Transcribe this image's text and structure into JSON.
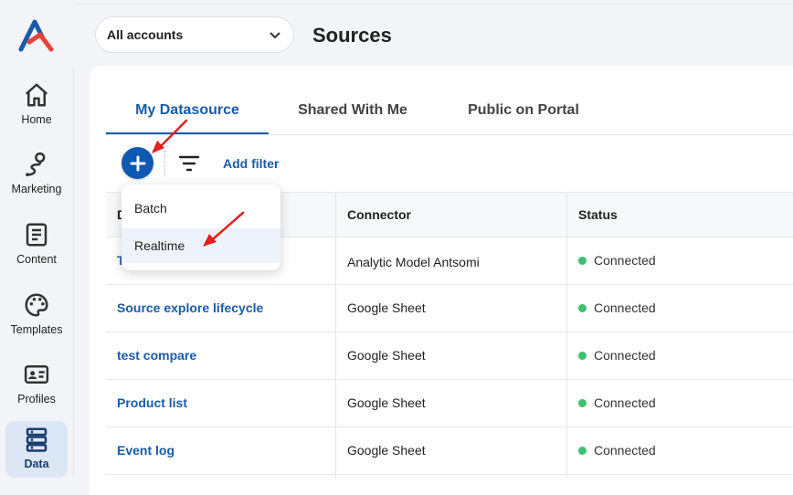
{
  "sidebar": {
    "items": [
      {
        "label": "Home",
        "icon": "home-icon"
      },
      {
        "label": "Marketing",
        "icon": "route-icon"
      },
      {
        "label": "Content",
        "icon": "document-icon"
      },
      {
        "label": "Templates",
        "icon": "palette-icon"
      },
      {
        "label": "Profiles",
        "icon": "id-card-icon"
      },
      {
        "label": "Data",
        "icon": "database-icon",
        "active": true
      }
    ]
  },
  "header": {
    "account_select": "All accounts",
    "title": "Sources"
  },
  "tabs": [
    {
      "label": "My Datasource",
      "active": true
    },
    {
      "label": "Shared With Me"
    },
    {
      "label": "Public on Portal"
    }
  ],
  "toolbar": {
    "add_filter": "Add filter"
  },
  "menu": {
    "items": [
      "Batch",
      "Realtime"
    ]
  },
  "table": {
    "columns": [
      "D",
      "Connector",
      "Status"
    ],
    "rows": [
      {
        "name": "T",
        "connector": "Analytic Model Antsomi",
        "status": "Connected"
      },
      {
        "name": "Source explore lifecycle",
        "connector": "Google Sheet",
        "status": "Connected"
      },
      {
        "name": "test compare",
        "connector": "Google Sheet",
        "status": "Connected"
      },
      {
        "name": "Product list",
        "connector": "Google Sheet",
        "status": "Connected"
      },
      {
        "name": "Event log",
        "connector": "Google Sheet",
        "status": "Connected"
      }
    ]
  },
  "colors": {
    "accent": "#1a5ba8",
    "button": "#1059b2",
    "status_connected": "#3fbf6f",
    "annotation_arrow": "#e0201f"
  }
}
